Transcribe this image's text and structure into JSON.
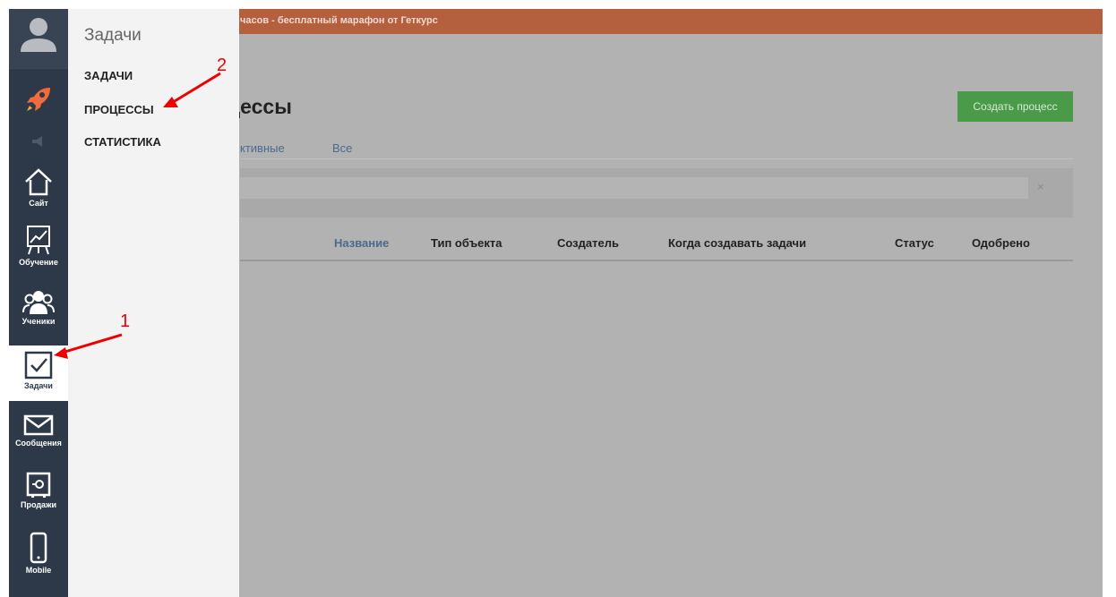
{
  "banner": {
    "text": "часов - бесплатный марафон от Геткурс"
  },
  "page": {
    "title": "цессы",
    "create_button": "Создать процесс",
    "tabs": [
      {
        "label": "ктивные"
      },
      {
        "label": "Все"
      }
    ],
    "filter_clear": "×",
    "columns": [
      "Название",
      "Тип объекта",
      "Создатель",
      "Когда создавать задачи",
      "Статус",
      "Одобрено"
    ]
  },
  "sidebar": {
    "items": [
      {
        "label": "",
        "icon": "user-avatar-icon"
      },
      {
        "label": "",
        "icon": "rocket-icon"
      },
      {
        "label": "",
        "icon": "megaphone-icon"
      },
      {
        "label": "Сайт",
        "icon": "home-icon"
      },
      {
        "label": "Обучение",
        "icon": "chart-board-icon"
      },
      {
        "label": "Ученики",
        "icon": "users-icon"
      },
      {
        "label": "Задачи",
        "icon": "checkbox-icon",
        "active": true
      },
      {
        "label": "Сообщения",
        "icon": "envelope-icon"
      },
      {
        "label": "Продажи",
        "icon": "safe-icon"
      },
      {
        "label": "Mobile",
        "icon": "phone-icon"
      }
    ]
  },
  "submenu": {
    "title": "Задачи",
    "items": [
      {
        "label": "ЗАДАЧИ"
      },
      {
        "label": "ПРОЦЕССЫ"
      },
      {
        "label": "СТАТИСТИКА"
      }
    ]
  },
  "annotations": {
    "one": "1",
    "two": "2"
  },
  "colors": {
    "banner": "#b4603f",
    "sidebar": "#2d3848",
    "accent_green": "#4a9a4a",
    "arrow_red": "#e00000"
  }
}
